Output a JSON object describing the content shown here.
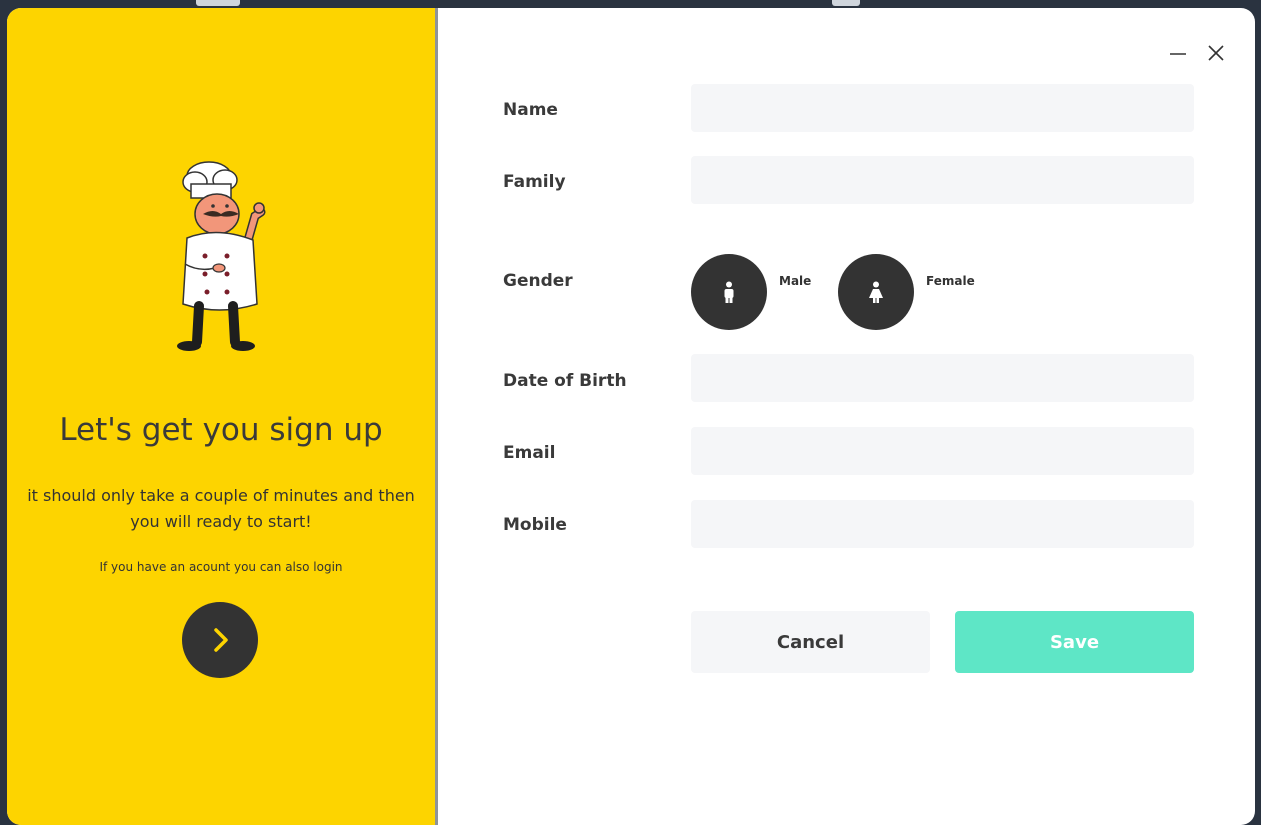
{
  "left_panel": {
    "headline": "Let's get you sign up",
    "subtext": "it should only take a couple of minutes and then you will ready to start!",
    "login_hint": "If you have an acount you can also login",
    "accent_color": "#fdd400",
    "illustration": "chef-illustration"
  },
  "window_controls": {
    "minimize_icon": "minimize-icon",
    "close_icon": "close-icon"
  },
  "form": {
    "name_label": "Name",
    "name_value": "",
    "family_label": "Family",
    "family_value": "",
    "gender_label": "Gender",
    "gender_options": [
      {
        "label": "Male",
        "icon": "male-icon"
      },
      {
        "label": "Female",
        "icon": "female-icon"
      }
    ],
    "dob_label": "Date of Birth",
    "dob_value": "",
    "email_label": "Email",
    "email_value": "",
    "mobile_label": "Mobile",
    "mobile_value": ""
  },
  "actions": {
    "cancel_label": "Cancel",
    "save_label": "Save",
    "save_color": "#5ee6c6"
  }
}
